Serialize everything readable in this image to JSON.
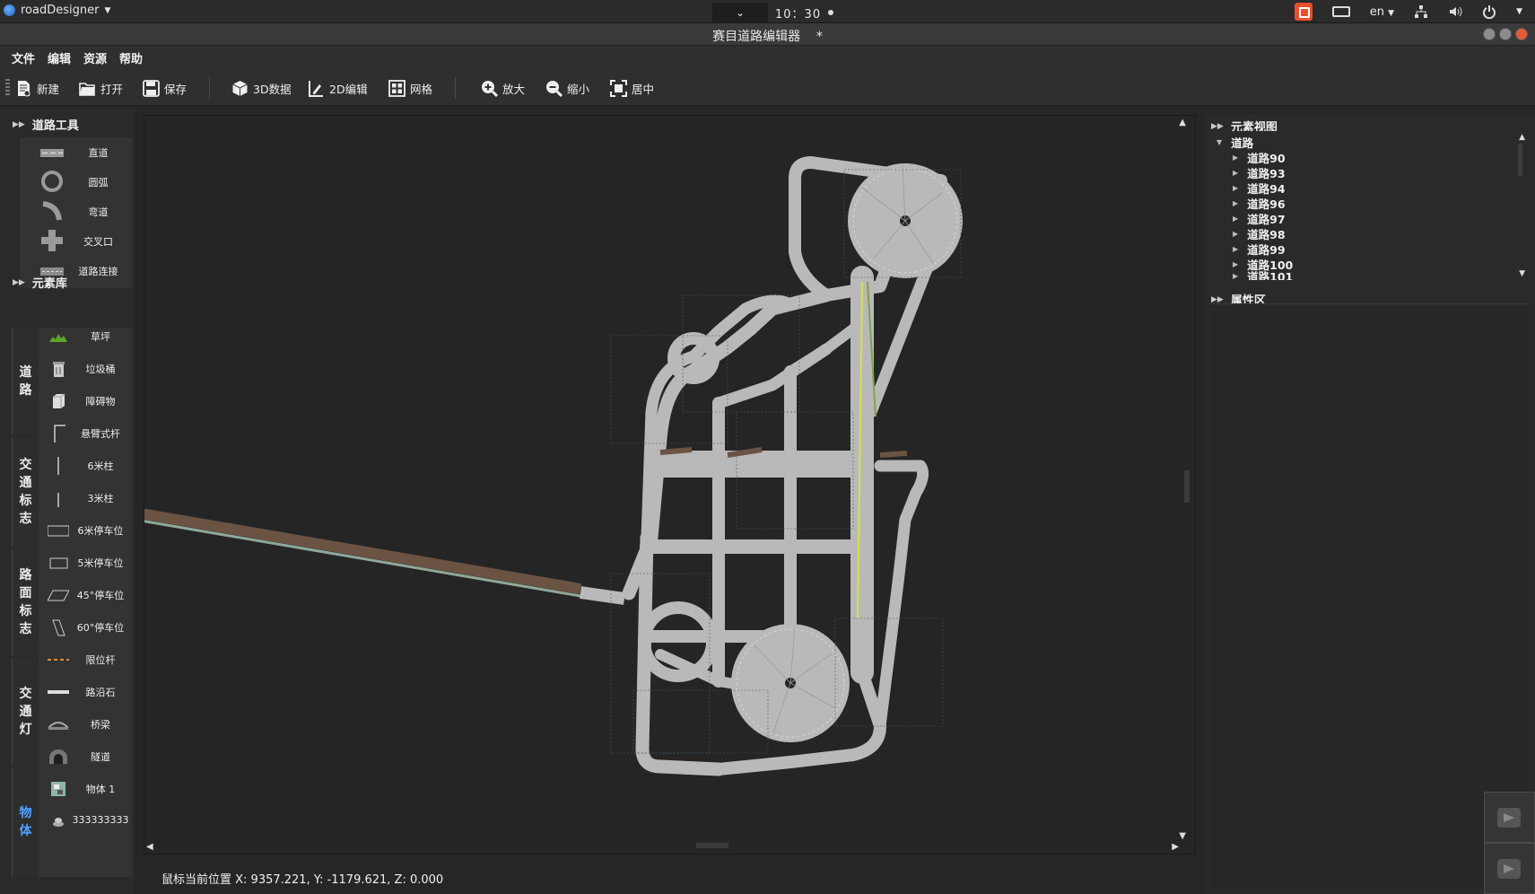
{
  "system": {
    "app_name": "roadDesigner",
    "dropdown_arrow": "⌄",
    "clock": "10：30",
    "lang": "en"
  },
  "window": {
    "title": "赛目道路编辑器    *"
  },
  "menu": [
    "文件",
    "编辑",
    "资源",
    "帮助"
  ],
  "toolbar": {
    "new": "新建",
    "open": "打开",
    "save": "保存",
    "data3d": "3D数据",
    "edit2d": "2D编辑",
    "grid": "网格",
    "zoom_in": "放大",
    "zoom_out": "缩小",
    "center": "居中"
  },
  "road_tools": {
    "title": "道路工具",
    "items": [
      "直道",
      "圆弧",
      "弯道",
      "交叉口",
      "道路连接"
    ]
  },
  "element_library": {
    "title": "元素库",
    "tabs": [
      "道\n路",
      "交\n通\n标\n志",
      "路\n面\n标\n志",
      "交\n通\n灯",
      "物\n体"
    ],
    "active_tab": 4,
    "items": [
      "草坪",
      "垃圾桶",
      "障碍物",
      "悬臂式杆",
      "6米柱",
      "3米柱",
      "6米停车位",
      "5米停车位",
      "45°停车位",
      "60°停车位",
      "限位杆",
      "路沿石",
      "桥梁",
      "隧道",
      "物体 1",
      "333333333"
    ]
  },
  "status": {
    "coords": "鼠标当前位置 X: 9357.221, Y: -1179.621, Z: 0.000"
  },
  "element_view": {
    "title": "元素视图",
    "root": "道路",
    "items": [
      "道路90",
      "道路93",
      "道路94",
      "道路96",
      "道路97",
      "道路98",
      "道路99",
      "道路100",
      "道路101"
    ]
  },
  "attributes": {
    "title": "属性区"
  },
  "colors": {
    "road": "#b9b9b9",
    "road_edge": "#9a9a9a",
    "center_line": "#d8e04a",
    "brown_road": "#6b5344",
    "canvas_bg": "#252525",
    "accent_tab": "#4ea3ff"
  }
}
